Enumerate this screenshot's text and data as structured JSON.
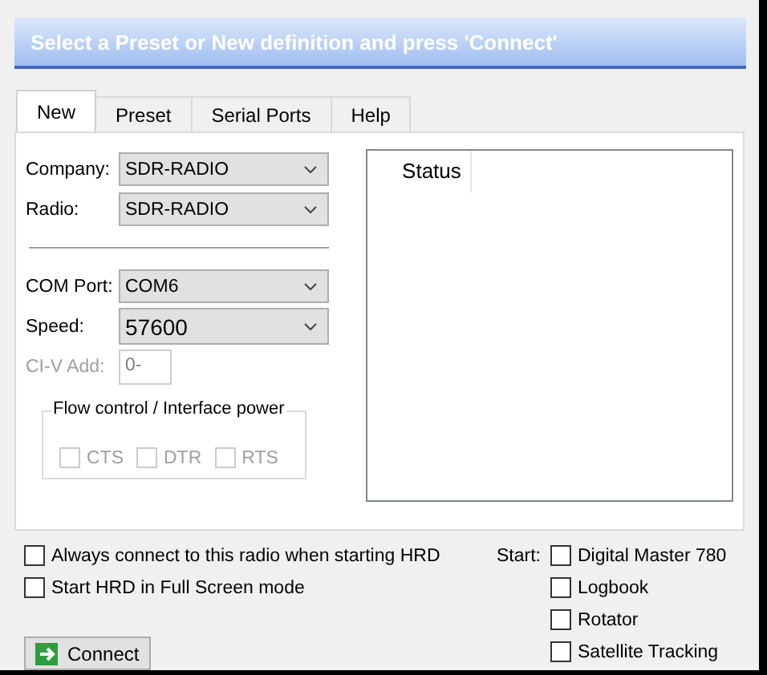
{
  "title": "Select a Preset or New definition and press 'Connect'",
  "tabs": [
    {
      "label": "New",
      "selected": true
    },
    {
      "label": "Preset",
      "selected": false
    },
    {
      "label": "Serial Ports",
      "selected": false
    },
    {
      "label": "Help",
      "selected": false
    }
  ],
  "fields": [
    {
      "label": "Company:",
      "value": "SDR-RADIO",
      "kind": "dropdown",
      "disabled": false
    },
    {
      "label": "Radio:",
      "value": "SDR-RADIO",
      "kind": "dropdown",
      "disabled": false
    },
    {
      "kind": "separator"
    },
    {
      "label": "COM Port:",
      "value": "COM6",
      "kind": "dropdown",
      "disabled": false
    },
    {
      "label": "Speed:",
      "value": "57600",
      "kind": "dropdown",
      "disabled": false
    },
    {
      "label": "CI-V Add:",
      "value": "0-",
      "kind": "text",
      "disabled": true
    }
  ],
  "flow_control": {
    "title": "Flow control / Interface power",
    "options": [
      {
        "label": "CTS",
        "checked": false,
        "disabled": true
      },
      {
        "label": "DTR",
        "checked": false,
        "disabled": true
      },
      {
        "label": "RTS",
        "checked": false,
        "disabled": true
      }
    ]
  },
  "status_list": {
    "columns": [
      "Status"
    ]
  },
  "options": [
    {
      "label": "Always connect to this radio when starting HRD",
      "checked": false
    },
    {
      "label": "Start HRD in Full Screen mode",
      "checked": false
    }
  ],
  "start": {
    "label": "Start:",
    "items": [
      {
        "label": "Digital Master 780",
        "checked": false
      },
      {
        "label": "Logbook",
        "checked": false
      },
      {
        "label": "Rotator",
        "checked": false
      },
      {
        "label": "Satellite Tracking",
        "checked": false
      }
    ]
  },
  "connect_button": "Connect"
}
